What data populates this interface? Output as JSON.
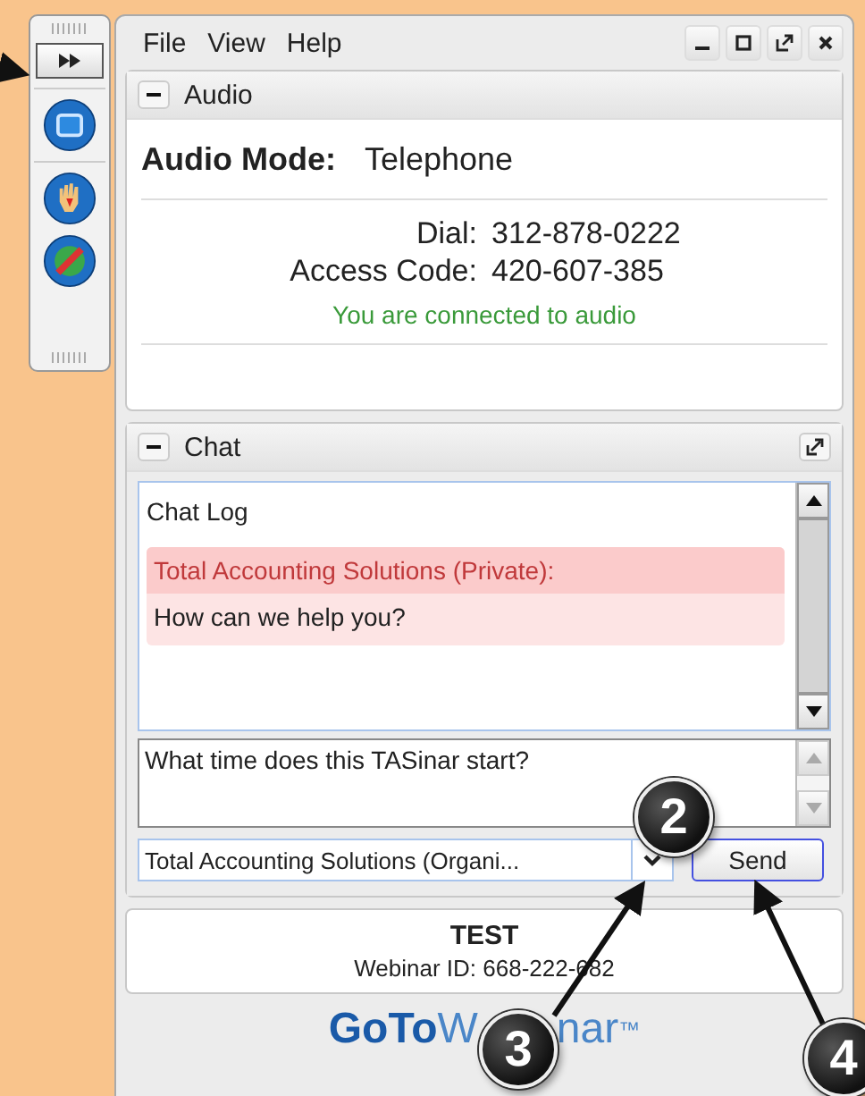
{
  "toolbar": {
    "buttons": [
      {
        "kind": "expand"
      },
      {
        "kind": "screen"
      },
      {
        "kind": "hand"
      },
      {
        "kind": "audio"
      }
    ]
  },
  "menu": [
    "File",
    "View",
    "Help"
  ],
  "audio": {
    "title": "Audio",
    "expanded": true,
    "mode_label": "Audio Mode:",
    "mode_value": "Telephone",
    "dial_label": "Dial:",
    "dial": "312-878-0222",
    "access_label": "Access Code:",
    "access_code": "420-607-385",
    "status": "You are connected to audio"
  },
  "chat": {
    "title": "Chat",
    "expanded": true,
    "log_title": "Chat Log",
    "messages": [
      {
        "sender": "Total Accounting Solutions (Private):",
        "text": "How can we help you?",
        "private": true
      }
    ],
    "input": "What time does this TASinar start?",
    "recipient": "Total Accounting Solutions (Organi...",
    "send": "Send"
  },
  "footer": {
    "title": "TEST",
    "webinar_id": "Webinar ID: 668-222-682",
    "logo_strong": "GoTo",
    "logo_rest": "W",
    "logo_tail": "nar",
    "logo_mark": "™"
  },
  "callouts": [
    {
      "number": "2"
    },
    {
      "number": "3"
    },
    {
      "number": "4"
    }
  ]
}
